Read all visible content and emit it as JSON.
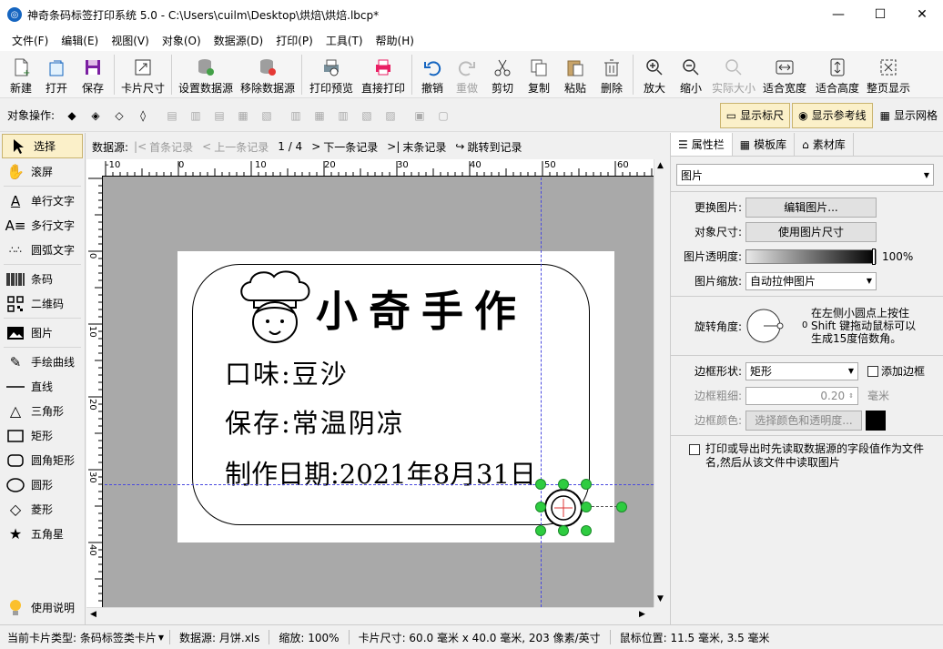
{
  "window": {
    "title": "神奇条码标签打印系统 5.0 - C:\\Users\\cuilm\\Desktop\\烘焙\\烘焙.lbcp*"
  },
  "menu": [
    "文件(F)",
    "编辑(E)",
    "视图(V)",
    "对象(O)",
    "数据源(D)",
    "打印(P)",
    "工具(T)",
    "帮助(H)"
  ],
  "toolbar": {
    "new": "新建",
    "open": "打开",
    "save": "保存",
    "card_size": "卡片尺寸",
    "set_ds": "设置数据源",
    "remove_ds": "移除数据源",
    "preview": "打印预览",
    "print": "直接打印",
    "undo": "撤销",
    "redo": "重做",
    "cut": "剪切",
    "copy": "复制",
    "paste": "粘贴",
    "delete": "删除",
    "zoom_in": "放大",
    "zoom_out": "缩小",
    "actual": "实际大小",
    "fit_w": "适合宽度",
    "fit_h": "适合高度",
    "full": "整页显示"
  },
  "objbar": {
    "label": "对象操作:",
    "ruler": "显示标尺",
    "guides": "显示参考线",
    "grid": "显示网格"
  },
  "tools": [
    "选择",
    "滚屏",
    "单行文字",
    "多行文字",
    "圆弧文字",
    "条码",
    "二维码",
    "图片",
    "手绘曲线",
    "直线",
    "三角形",
    "矩形",
    "圆角矩形",
    "圆形",
    "菱形",
    "五角星",
    "使用说明"
  ],
  "records": {
    "label": "数据源:",
    "first": "首条记录",
    "prev": "上一条记录",
    "pos": "1 / 4",
    "next": "下一条记录",
    "last": "末条记录",
    "jump": "跳转到记录"
  },
  "ruler": {
    "h": [
      "-10",
      "0",
      "10",
      "20",
      "30",
      "40",
      "50",
      "60"
    ],
    "v": [
      "0",
      "10",
      "20",
      "30",
      "40"
    ]
  },
  "label": {
    "title": "小奇手作",
    "line1": "口味:豆沙",
    "line2": "保存:常温阴凉",
    "line3": "制作日期:2021年8月31日"
  },
  "panel": {
    "tabs": [
      "属性栏",
      "模板库",
      "素材库"
    ],
    "type": "图片",
    "change_img": "更换图片:",
    "edit_img": "编辑图片...",
    "obj_size": "对象尺寸:",
    "use_img_size": "使用图片尺寸",
    "opacity": "图片透明度:",
    "opacity_val": "100%",
    "scale": "图片缩放:",
    "scale_val": "自动拉伸图片",
    "rotate": "旋转角度:",
    "rotate_val": "0",
    "rotate_hint": "在左侧小圆点上按住Shift 键拖动鼠标可以生成15度倍数角。",
    "border_shape": "边框形状:",
    "border_shape_val": "矩形",
    "add_border": "添加边框",
    "border_w": "边框粗细:",
    "border_w_val": "0.20",
    "border_unit": "毫米",
    "border_color": "边框颜色:",
    "pick_color": "选择颜色和透明度...",
    "read_ds": "打印或导出时先读取数据源的字段值作为文件名,然后从该文件中读取图片"
  },
  "status": {
    "card_type": "当前卡片类型: 条码标签类卡片",
    "ds": "数据源: 月饼.xls",
    "zoom": "缩放: 100%",
    "size": "卡片尺寸: 60.0 毫米 x 40.0 毫米, 203 像素/英寸",
    "mouse": "鼠标位置: 11.5 毫米, 3.5 毫米"
  }
}
